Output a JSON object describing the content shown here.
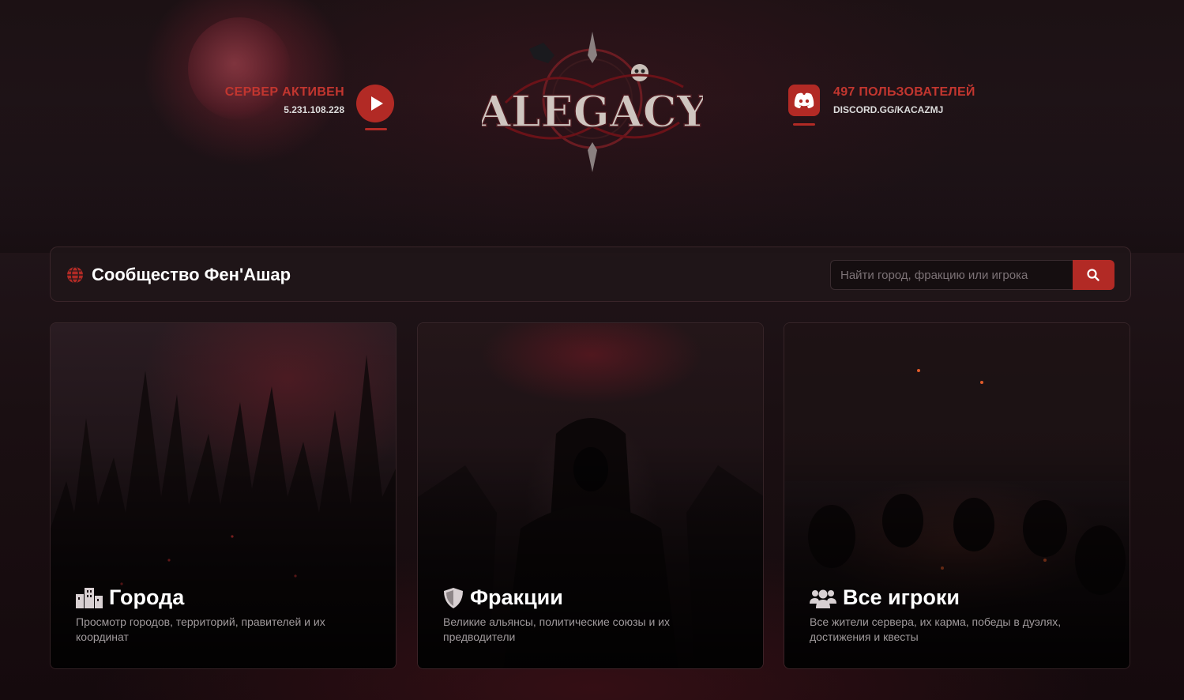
{
  "header": {
    "server_status": "СЕРВЕР АКТИВЕН",
    "server_ip": "5.231.108.228",
    "logo_text": "ALEGACY",
    "discord_users": "497 ПОЛЬЗОВАТЕЛЕЙ",
    "discord_link": "DISCORD.GG/KACAZMJ"
  },
  "community": {
    "title": "Сообщество Фен'Ашар",
    "search_placeholder": "Найти город, фракцию или игрока"
  },
  "cards": [
    {
      "title": "Города",
      "description": "Просмотр городов, территорий, правителей и их координат",
      "icon": "city-icon"
    },
    {
      "title": "Фракции",
      "description": "Великие альянсы, политические союзы и их предводители",
      "icon": "shield-icon"
    },
    {
      "title": "Все игроки",
      "description": "Все жители сервера, их карма, победы в дуэлях, достижения и квесты",
      "icon": "users-icon"
    }
  ],
  "colors": {
    "accent": "#b22a25",
    "accent_text": "#c2362f",
    "background": "#1c1114"
  }
}
